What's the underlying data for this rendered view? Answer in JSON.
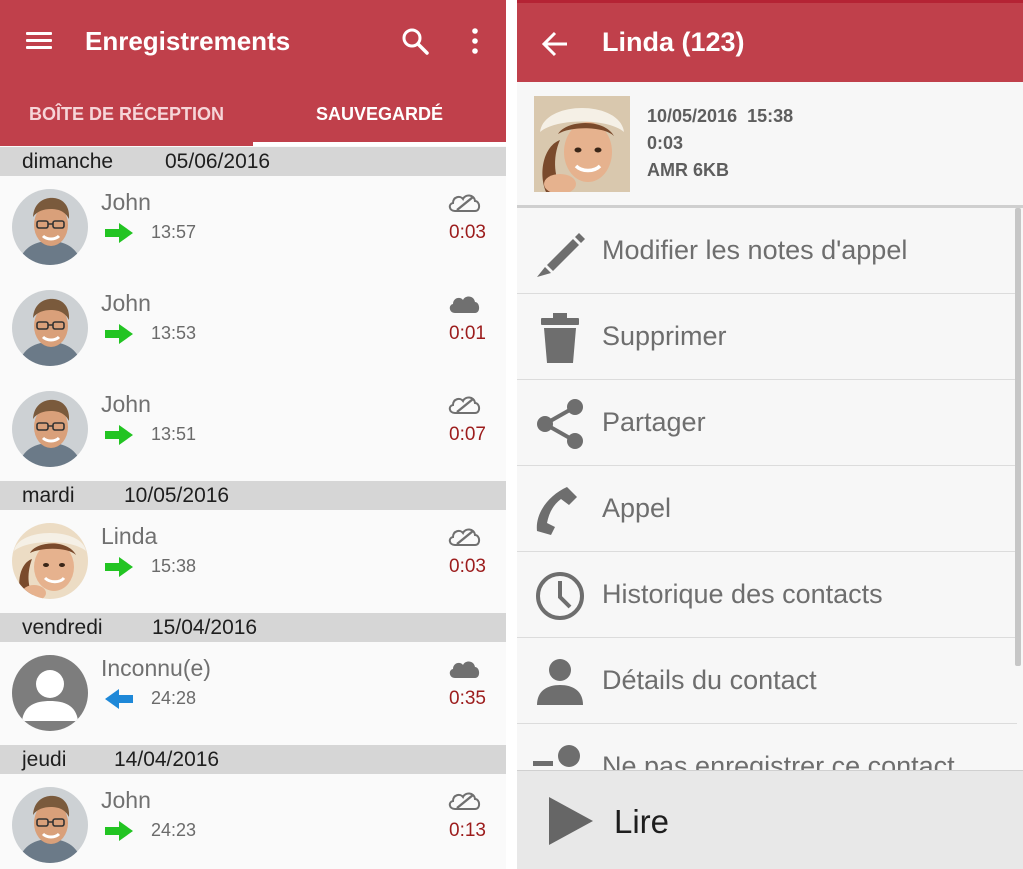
{
  "left": {
    "title": "Enregistrements",
    "tabs": [
      {
        "label": "BOÎTE DE RÉCEPTION",
        "selected": false
      },
      {
        "label": "SAUVEGARDÉ",
        "selected": true
      }
    ],
    "groups": [
      {
        "day": "dimanche",
        "date": "05/06/2016"
      },
      {
        "day": "mardi",
        "date": "10/05/2016"
      },
      {
        "day": "vendredi",
        "date": "15/04/2016"
      },
      {
        "day": "jeudi",
        "date": "14/04/2016"
      }
    ],
    "recordings": [
      {
        "name": "John",
        "time": "13:57",
        "duration": "0:03",
        "direction": "outgoing",
        "cloud": "cloud-off-icon",
        "avatar": "john-avatar"
      },
      {
        "name": "John",
        "time": "13:53",
        "duration": "0:01",
        "direction": "outgoing",
        "cloud": "cloud-icon",
        "avatar": "john-avatar"
      },
      {
        "name": "John",
        "time": "13:51",
        "duration": "0:07",
        "direction": "outgoing",
        "cloud": "cloud-off-icon",
        "avatar": "john-avatar"
      },
      {
        "name": "Linda",
        "time": "15:38",
        "duration": "0:03",
        "direction": "outgoing",
        "cloud": "cloud-off-icon",
        "avatar": "linda-avatar"
      },
      {
        "name": "Inconnu(e)",
        "time": "24:28",
        "duration": "0:35",
        "direction": "incoming",
        "cloud": "cloud-icon",
        "avatar": "unknown-avatar"
      },
      {
        "name": "John",
        "time": "24:23",
        "duration": "0:13",
        "direction": "outgoing",
        "cloud": "cloud-off-icon",
        "avatar": "john-avatar"
      }
    ]
  },
  "right": {
    "title": "Linda (123)",
    "info": {
      "date": "10/05/2016",
      "time": "15:38",
      "duration": "0:03",
      "format": "AMR 6KB"
    },
    "menu": [
      {
        "label": "Modifier les notes d'appel",
        "icon": "pencil-icon"
      },
      {
        "label": "Supprimer",
        "icon": "trash-icon"
      },
      {
        "label": "Partager",
        "icon": "share-icon"
      },
      {
        "label": "Appel",
        "icon": "phone-icon"
      },
      {
        "label": "Historique des contacts",
        "icon": "clock-icon"
      },
      {
        "label": "Détails du contact",
        "icon": "person-icon"
      },
      {
        "label": "Ne pas enregistrer ce contact",
        "icon": "person-remove-icon"
      }
    ],
    "play_label": "Lire"
  },
  "colors": {
    "app_bar": "#c0404b",
    "outgoing_arrow": "#22c422",
    "incoming_arrow": "#1e88d8",
    "duration": "#9c1c1c"
  }
}
